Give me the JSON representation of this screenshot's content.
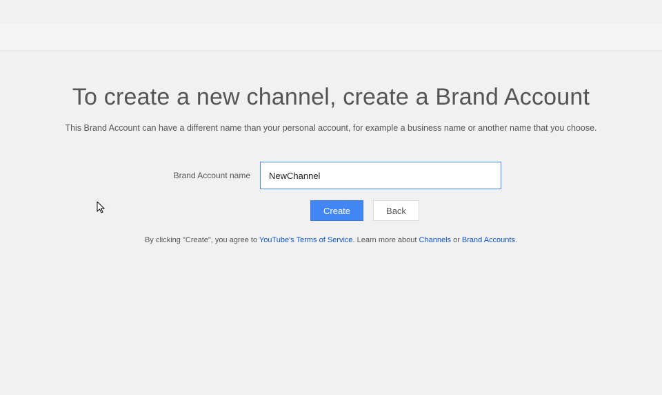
{
  "title": "To create a new channel, create a Brand Account",
  "subtitle": "This Brand Account can have a different name than your personal account, for example a business name or another name that you choose.",
  "form": {
    "label": "Brand Account name",
    "value": "NewChannel"
  },
  "buttons": {
    "create": "Create",
    "back": "Back"
  },
  "legal": {
    "prefix": "By clicking \"Create\", you agree to ",
    "tos": "YouTube's Terms of Service",
    "mid": ". Learn more about ",
    "channels": "Channels",
    "or": " or ",
    "brand": "Brand Accounts",
    "suffix": "."
  }
}
